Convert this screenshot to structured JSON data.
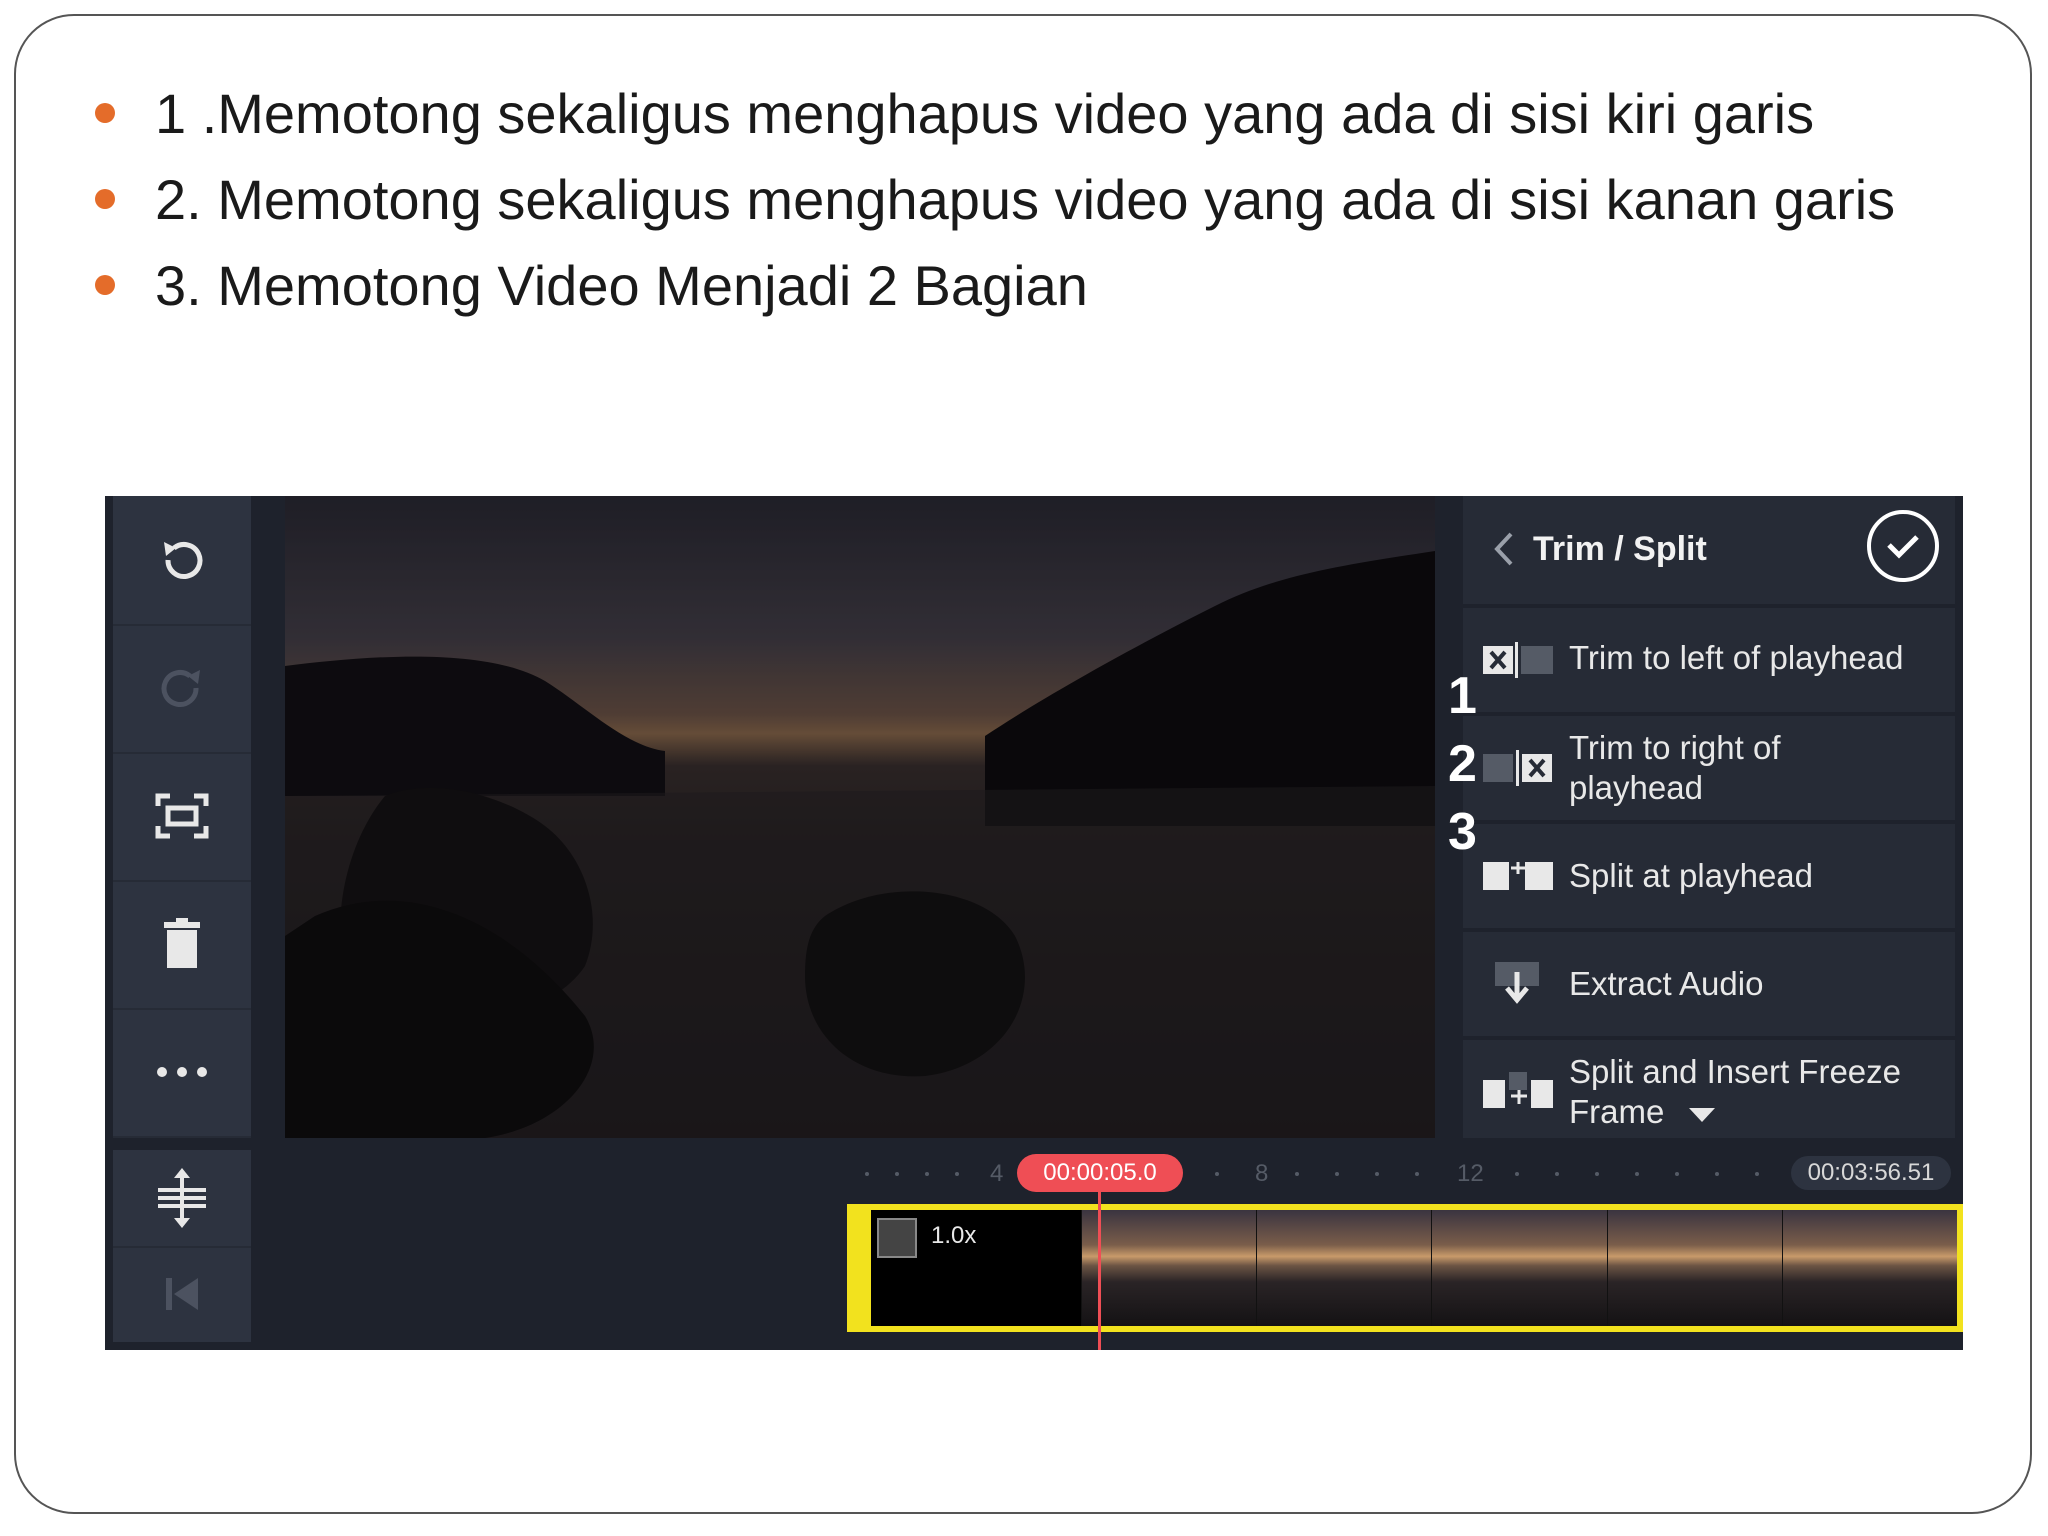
{
  "bullets": [
    "1 .Memotong sekaligus menghapus video yang ada di sisi kiri garis",
    "2. Memotong sekaligus menghapus video yang ada di sisi kanan garis",
    "3. Memotong Video Menjadi 2 Bagian"
  ],
  "panel": {
    "title": "Trim / Split",
    "items": [
      {
        "label_lines": [
          "Trim to left of playhead"
        ],
        "icon": "trim-left-icon"
      },
      {
        "label_lines": [
          "Trim to right of",
          "playhead"
        ],
        "icon": "trim-right-icon"
      },
      {
        "label_lines": [
          "Split at playhead"
        ],
        "icon": "split-icon"
      },
      {
        "label_lines": [
          "Extract Audio"
        ],
        "icon": "extract-audio-icon"
      },
      {
        "label_lines": [
          "Split and Insert Freeze",
          "Frame"
        ],
        "icon": "freeze-frame-icon"
      }
    ]
  },
  "callouts": [
    "1",
    "2",
    "3"
  ],
  "toolbar": {
    "icons": [
      "undo-icon",
      "redo-icon",
      "fullscreen-icon",
      "delete-icon",
      "more-icon",
      "layer-adjust-icon",
      "jump-start-icon"
    ]
  },
  "timeline": {
    "playhead_time": "00:00:05.0",
    "end_time": "00:03:56.51",
    "ruler_marks": [
      "4",
      "8",
      "12"
    ],
    "clip_speed": "1.0x"
  },
  "colors": {
    "bullet": "#e46c2a",
    "playhead": "#ef4e55",
    "clip_border": "#f2e21e",
    "panel_bg": "#262b36"
  }
}
